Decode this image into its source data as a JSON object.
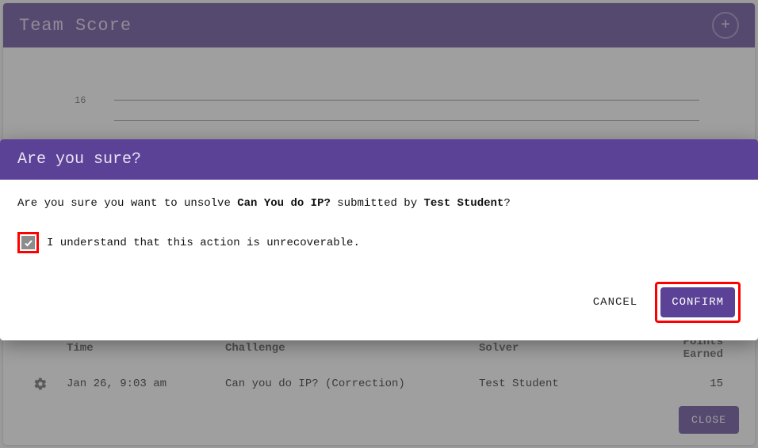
{
  "header": {
    "title": "Team Score"
  },
  "chart_data": {
    "type": "line",
    "title": "",
    "xlabel": "",
    "ylabel": "",
    "y_ticks_visible": [
      16.0
    ],
    "series": [],
    "note": "chart mostly obscured by modal"
  },
  "table": {
    "columns": [
      "Time",
      "Challenge",
      "Solver",
      "Points Earned"
    ],
    "rows": [
      {
        "time": "Jan 26, 9:03 am",
        "challenge": "Can you do IP? (Correction)",
        "solver": "Test Student",
        "points": 15
      }
    ]
  },
  "close_label": "CLOSE",
  "modal": {
    "title": "Are you sure?",
    "prefix": "Are you sure you want to unsolve ",
    "challenge_name": "Can You do IP?",
    "mid": " submitted by ",
    "solver_name": "Test Student",
    "suffix": "?",
    "checkbox_label": "I understand that this action is unrecoverable.",
    "checkbox_checked": true,
    "cancel_label": "CANCEL",
    "confirm_label": "CONFIRM"
  }
}
